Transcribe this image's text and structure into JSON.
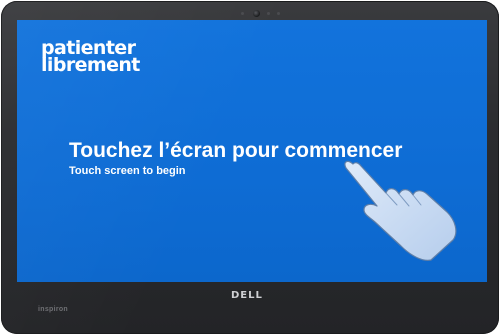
{
  "device": {
    "brand": "DELL",
    "model_label": "inspiron"
  },
  "screen": {
    "background_color": "#0f6fd8",
    "logo": {
      "line1": "patienter",
      "line2": "librement"
    },
    "prompt": {
      "title": "Touchez l’écran pour commencer",
      "subtitle": "Touch screen to begin"
    },
    "gesture_icon": "pointing-hand-icon"
  }
}
